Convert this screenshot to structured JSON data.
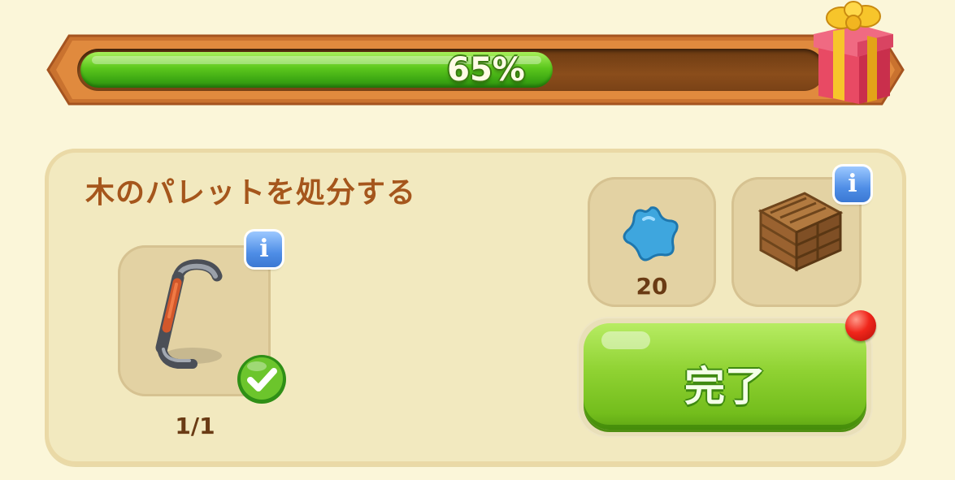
{
  "progress": {
    "percent_label": "65%",
    "value": 0.65,
    "reward_icon": "gift-box-icon"
  },
  "quest": {
    "title": "木のパレットを処分する",
    "requirement": {
      "icon": "crowbar-icon",
      "count": "1/1",
      "completed": true,
      "info_label": "i"
    },
    "rewards": [
      {
        "icon": "blue-star-icon",
        "amount": "20"
      },
      {
        "icon": "wooden-crate-icon",
        "info_label": "i"
      }
    ],
    "complete_button": {
      "label": "完了"
    }
  },
  "colors": {
    "background": "#fbf6d9",
    "progress_fill": "#5cc71d",
    "title_text": "#a5561c",
    "button_green": "#8fd232",
    "info_blue": "#4f8ee6",
    "notification_red": "#f0261b"
  }
}
